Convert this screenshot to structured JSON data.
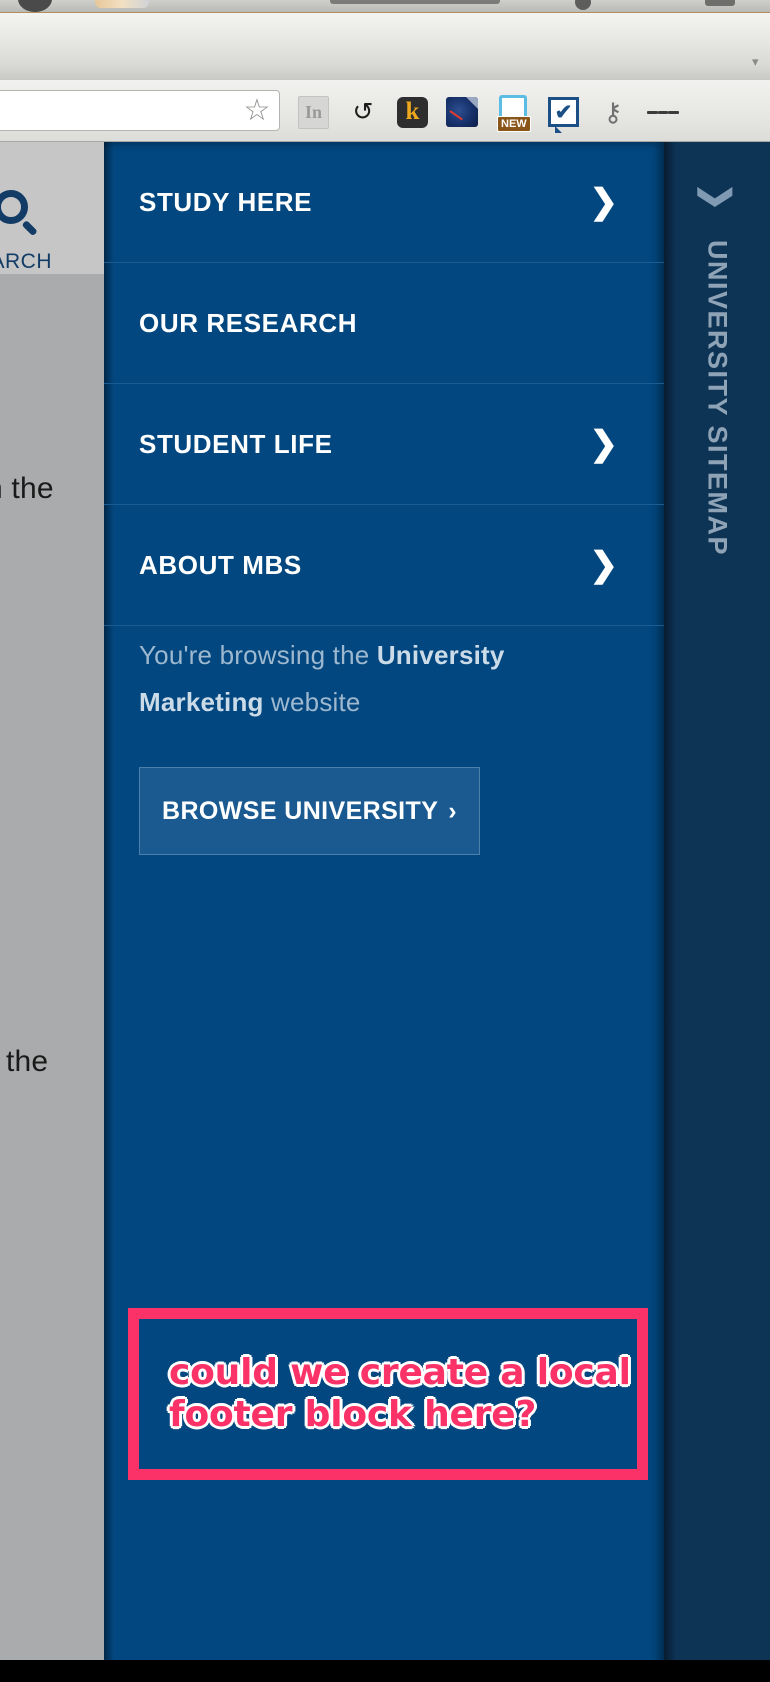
{
  "browser": {
    "omnibox_value": "",
    "star_icon": "bookmark-star-icon",
    "extensions": [
      {
        "name": "linkedin-extension-icon",
        "label": "In"
      },
      {
        "name": "sync-extension-icon",
        "label": "↺"
      },
      {
        "name": "kaltura-extension-icon",
        "label": "k"
      },
      {
        "name": "speed-gauge-extension-icon",
        "label": ""
      },
      {
        "name": "screenshot-extension-icon",
        "label": "NEW"
      },
      {
        "name": "checkbox-extension-icon",
        "label": "✔"
      },
      {
        "name": "key-extension-icon",
        "label": "⚷"
      },
      {
        "name": "browser-menu-icon",
        "label": ""
      }
    ]
  },
  "left_overlay": {
    "search_label": "EARCH",
    "search_icon": "magnifier-icon",
    "fragment_one": "n the",
    "fragment_two": "the"
  },
  "nav": {
    "items": [
      {
        "label": "STUDY HERE",
        "chevron": "❯",
        "has_chevron": true
      },
      {
        "label": "OUR RESEARCH",
        "chevron": "",
        "has_chevron": false
      },
      {
        "label": "STUDENT LIFE",
        "chevron": "❯",
        "has_chevron": true
      },
      {
        "label": "ABOUT MBS",
        "chevron": "❯",
        "has_chevron": true
      }
    ],
    "browsing_prefix": "You're browsing the ",
    "browsing_bold": "University Marketing",
    "browsing_suffix": " website",
    "browse_button_label": "BROWSE UNIVERSITY",
    "browse_button_chevron": "›"
  },
  "annotation": {
    "text": "could we create a local footer block here?",
    "border_color": "#fb3268",
    "text_color": "#fb3268",
    "outline_color": "#ffffff"
  },
  "sitemap": {
    "label": "UNIVERSITY SITEMAP",
    "chevron": "❯"
  },
  "colors": {
    "panel_blue": "#02477f",
    "panel_divider": "#1b5d92",
    "sitemap_blue": "#0d3355",
    "button_blue": "#1a5a91",
    "page_gray": "#a9abac",
    "search_chip_gray": "#c6c6c6",
    "deep_navy": "#123c66"
  }
}
